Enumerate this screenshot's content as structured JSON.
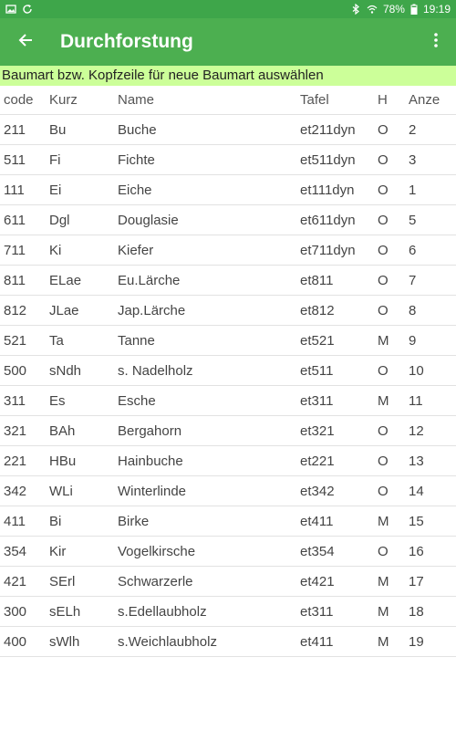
{
  "status_bar": {
    "battery": "78%",
    "time": "19:19",
    "icons": [
      "image-icon",
      "sync-icon",
      "bluetooth-icon",
      "wifi-icon",
      "battery-icon"
    ]
  },
  "app_bar": {
    "title": "Durchforstung",
    "back_icon": "arrow-back-icon",
    "menu_icon": "more-vert-icon"
  },
  "hint": "Baumart bzw. Kopfzeile für neue Baumart auswählen",
  "colors": {
    "status_bar": "#3ea64a",
    "app_bar": "#4caf50",
    "hint_bg": "#ccff99"
  },
  "table": {
    "headers": [
      "code",
      "Kurz",
      "Name",
      "Tafel",
      "H",
      "Anze"
    ],
    "rows": [
      [
        "211",
        "Bu",
        "Buche",
        "et211dyn",
        "O",
        "2"
      ],
      [
        "511",
        "Fi",
        "Fichte",
        "et511dyn",
        "O",
        "3"
      ],
      [
        "111",
        "Ei",
        "Eiche",
        "et111dyn",
        "O",
        "1"
      ],
      [
        "611",
        "Dgl",
        "Douglasie",
        "et611dyn",
        "O",
        "5"
      ],
      [
        "711",
        "Ki",
        "Kiefer",
        "et711dyn",
        "O",
        "6"
      ],
      [
        "811",
        "ELae",
        "Eu.Lärche",
        "et811",
        "O",
        "7"
      ],
      [
        "812",
        "JLae",
        "Jap.Lärche",
        "et812",
        "O",
        "8"
      ],
      [
        "521",
        "Ta",
        "Tanne",
        "et521",
        "M",
        "9"
      ],
      [
        "500",
        "sNdh",
        "s. Nadelholz",
        "et511",
        "O",
        "10"
      ],
      [
        "311",
        "Es",
        "Esche",
        "et311",
        "M",
        "11"
      ],
      [
        "321",
        "BAh",
        "Bergahorn",
        "et321",
        "O",
        "12"
      ],
      [
        "221",
        "HBu",
        "Hainbuche",
        "et221",
        "O",
        "13"
      ],
      [
        "342",
        "WLi",
        "Winterlinde",
        "et342",
        "O",
        "14"
      ],
      [
        "411",
        "Bi",
        "Birke",
        "et411",
        "M",
        "15"
      ],
      [
        "354",
        "Kir",
        "Vogelkirsche",
        "et354",
        "O",
        "16"
      ],
      [
        "421",
        "SErl",
        "Schwarzerle",
        "et421",
        "M",
        "17"
      ],
      [
        "300",
        "sELh",
        "s.Edellaubholz",
        "et311",
        "M",
        "18"
      ],
      [
        "400",
        "sWlh",
        "s.Weichlaubholz",
        "et411",
        "M",
        "19"
      ]
    ]
  }
}
